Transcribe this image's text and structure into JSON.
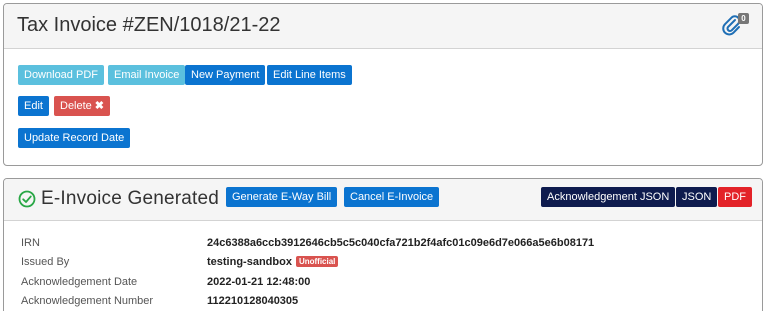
{
  "invoice": {
    "title": "Tax Invoice #ZEN/1018/21-22",
    "attachments_count": "0",
    "buttons": {
      "download_pdf": "Download PDF",
      "email_invoice": "Email Invoice",
      "new_payment": "New Payment",
      "edit_line_items": "Edit Line Items",
      "edit": "Edit",
      "delete": "Delete",
      "update_record_date": "Update Record Date"
    }
  },
  "einvoice": {
    "title": "E-Invoice Generated",
    "buttons": {
      "generate_eway_bill": "Generate E-Way Bill",
      "cancel_einvoice": "Cancel E-Invoice",
      "ack_json": "Acknowledgement JSON",
      "json": "JSON",
      "pdf": "PDF"
    },
    "fields": {
      "irn_label": "IRN",
      "irn_value": "24c6388a6ccb3912646cb5c5c040cfa721b2f4afc01c09e6d7e066a5e6b08171",
      "issued_by_label": "Issued By",
      "issued_by_value": "testing-sandbox",
      "issued_by_badge": "Unofficial",
      "ack_date_label": "Acknowledgement Date",
      "ack_date_value": "2022-01-21 12:48:00",
      "ack_number_label": "Acknowledgement Number",
      "ack_number_value": "112210128040305"
    }
  },
  "colors": {
    "info": "#5bc0de",
    "primary": "#0b74d0",
    "danger": "#d9534f",
    "navy": "#0e1b4e",
    "pdf_red": "#e32228",
    "success": "#28a745"
  },
  "icons": {
    "attachment": "paperclip-icon",
    "generated": "check-circle-icon",
    "delete": "times-icon"
  }
}
